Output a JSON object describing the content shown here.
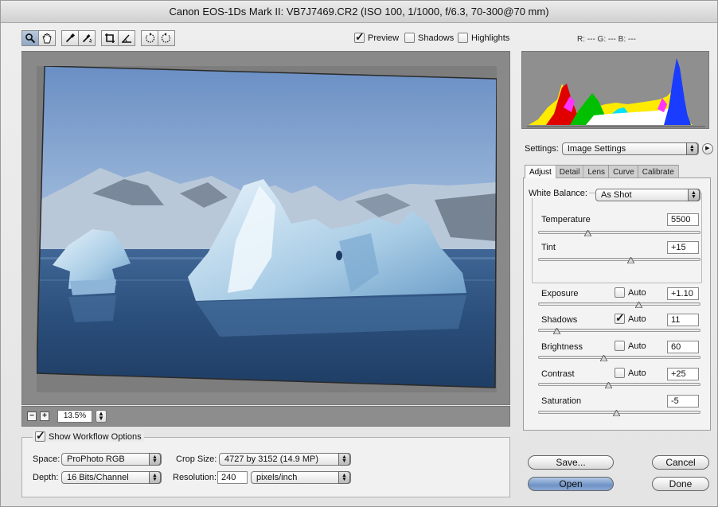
{
  "window": {
    "title": "Canon EOS-1Ds Mark II:  VB7J7469.CR2  (ISO 100, 1/1000, f/6.3, 70-300@70 mm)"
  },
  "toolbar": {
    "tools": [
      "zoom-tool",
      "hand-tool",
      "white-balance-tool",
      "color-sampler-tool",
      "crop-tool",
      "straighten-tool",
      "rotate-left-tool",
      "rotate-right-tool"
    ]
  },
  "options": {
    "preview": {
      "label": "Preview",
      "checked": true
    },
    "shadows": {
      "label": "Shadows",
      "checked": false
    },
    "highlights": {
      "label": "Highlights",
      "checked": false
    },
    "rgb": "R: ---   G: ---   B: ---"
  },
  "zoom": {
    "value": "13.5%",
    "minus": "−",
    "plus": "+"
  },
  "settings": {
    "label": "Settings:",
    "value": "Image Settings"
  },
  "tabs": [
    "Adjust",
    "Detail",
    "Lens",
    "Curve",
    "Calibrate"
  ],
  "white_balance": {
    "label": "White Balance:",
    "value": "As Shot"
  },
  "sliders": {
    "temperature": {
      "label": "Temperature",
      "value": "5500",
      "pos": 0.3
    },
    "tint": {
      "label": "Tint",
      "value": "+15",
      "pos": 0.57
    },
    "exposure": {
      "label": "Exposure",
      "value": "+1.10",
      "pos": 0.62,
      "auto_label": "Auto",
      "auto": false
    },
    "shadows": {
      "label": "Shadows",
      "value": "11",
      "pos": 0.11,
      "auto_label": "Auto",
      "auto": true
    },
    "brightness": {
      "label": "Brightness",
      "value": "60",
      "pos": 0.4,
      "auto_label": "Auto",
      "auto": false
    },
    "contrast": {
      "label": "Contrast",
      "value": "+25",
      "pos": 0.43,
      "auto_label": "Auto",
      "auto": false
    },
    "saturation": {
      "label": "Saturation",
      "value": "-5",
      "pos": 0.48
    }
  },
  "workflow": {
    "show_label": "Show Workflow Options",
    "space_label": "Space:",
    "space_value": "ProPhoto RGB",
    "depth_label": "Depth:",
    "depth_value": "16 Bits/Channel",
    "crop_label": "Crop Size:",
    "crop_value": "4727 by 3152  (14.9 MP)",
    "resolution_label": "Resolution:",
    "resolution_value": "240",
    "resolution_unit": "pixels/inch"
  },
  "buttons": {
    "save": "Save...",
    "open": "Open",
    "cancel": "Cancel",
    "done": "Done"
  }
}
